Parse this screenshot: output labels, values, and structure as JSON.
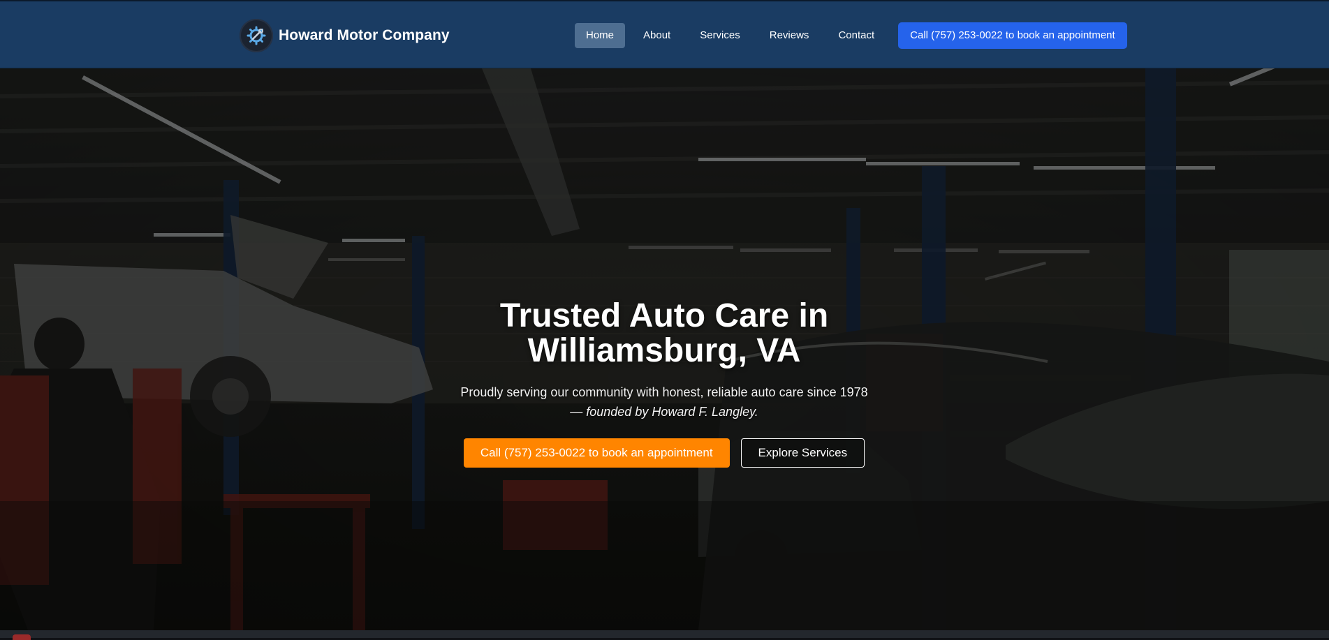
{
  "header": {
    "brand_name": "Howard Motor Company",
    "logo_icon": "wrench-gear-icon",
    "nav": [
      {
        "label": "Home",
        "active": true
      },
      {
        "label": "About",
        "active": false
      },
      {
        "label": "Services",
        "active": false
      },
      {
        "label": "Reviews",
        "active": false
      },
      {
        "label": "Contact",
        "active": false
      }
    ],
    "cta_label": "Call (757) 253-0022 to book an appointment"
  },
  "hero": {
    "title_line1": "Trusted Auto Care in",
    "title_line2": "Williamsburg, VA",
    "subtitle_text": "Proudly serving our community with honest, reliable auto care since 1978 —",
    "subtitle_emphasis": "founded by Howard F. Langley.",
    "primary_button": "Call (757) 253-0022 to book an appointment",
    "secondary_button": "Explore Services",
    "background": "auto repair garage interior"
  },
  "colors": {
    "header_bg": "#1a3c63",
    "nav_active_bg": "#4e6e91",
    "cta_blue": "#2563eb",
    "primary_orange": "#ff8500"
  }
}
